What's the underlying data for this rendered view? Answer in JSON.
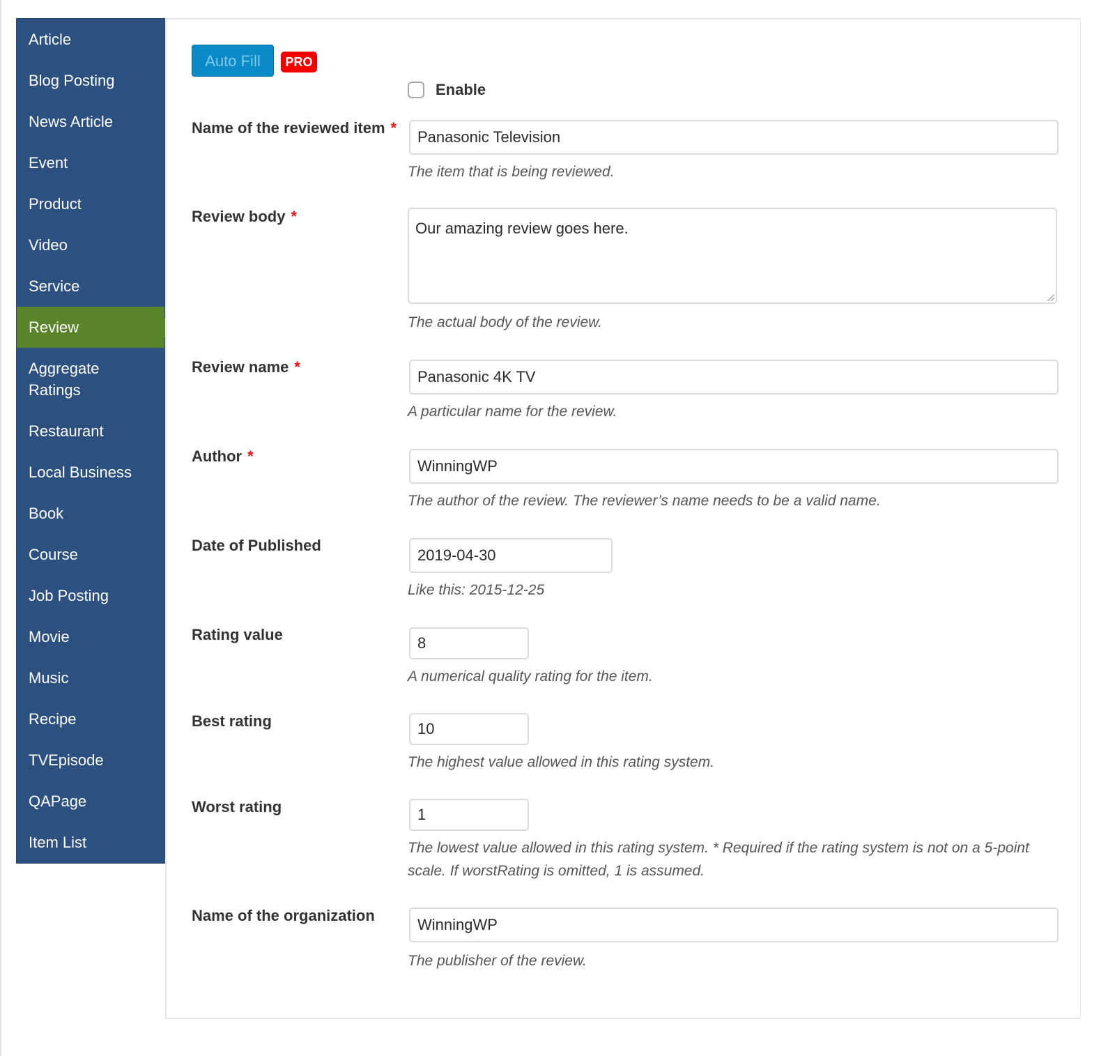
{
  "sidebar": {
    "items": [
      {
        "label": "Article"
      },
      {
        "label": "Blog Posting"
      },
      {
        "label": "News Article"
      },
      {
        "label": "Event"
      },
      {
        "label": "Product"
      },
      {
        "label": "Video"
      },
      {
        "label": "Service"
      },
      {
        "label": "Review",
        "active": true
      },
      {
        "label": "Aggregate Ratings"
      },
      {
        "label": "Restaurant"
      },
      {
        "label": "Local Business"
      },
      {
        "label": "Book"
      },
      {
        "label": "Course"
      },
      {
        "label": "Job Posting"
      },
      {
        "label": "Movie"
      },
      {
        "label": "Music"
      },
      {
        "label": "Recipe"
      },
      {
        "label": "TVEpisode"
      },
      {
        "label": "QAPage"
      },
      {
        "label": "Item List"
      }
    ]
  },
  "toolbar": {
    "autofill_label": "Auto Fill",
    "pro_badge": "PRO",
    "enable_label": "Enable",
    "enable_checked": false
  },
  "form": {
    "required_mark": "*",
    "item_name": {
      "label": "Name of the reviewed item",
      "value": "Panasonic Television",
      "help": "The item that is being reviewed."
    },
    "review_body": {
      "label": "Review body",
      "value": "Our amazing review goes here.",
      "help": "The actual body of the review."
    },
    "review_name": {
      "label": "Review name",
      "value": "Panasonic 4K TV",
      "help": "A particular name for the review."
    },
    "author": {
      "label": "Author",
      "value": "WinningWP",
      "help": "The author of the review. The reviewer’s name needs to be a valid name."
    },
    "date_published": {
      "label": "Date of Published",
      "value": "2019-04-30",
      "help": "Like this: 2015-12-25"
    },
    "rating_value": {
      "label": "Rating value",
      "value": "8",
      "help": "A numerical quality rating for the item."
    },
    "best_rating": {
      "label": "Best rating",
      "value": "10",
      "help": "The highest value allowed in this rating system."
    },
    "worst_rating": {
      "label": "Worst rating",
      "value": "1",
      "help": "The lowest value allowed in this rating system. * Required if the rating system is not on a 5-point scale. If worstRating is omitted, 1 is assumed."
    },
    "organization": {
      "label": "Name of the organization",
      "value": "WinningWP",
      "help": "The publisher of the review."
    }
  },
  "colors": {
    "sidebar_bg": "#2c5080",
    "active_bg": "#5a8429",
    "autofill_bg": "#0a8ac6",
    "pro_bg": "#f50000",
    "required": "#ee1111"
  }
}
